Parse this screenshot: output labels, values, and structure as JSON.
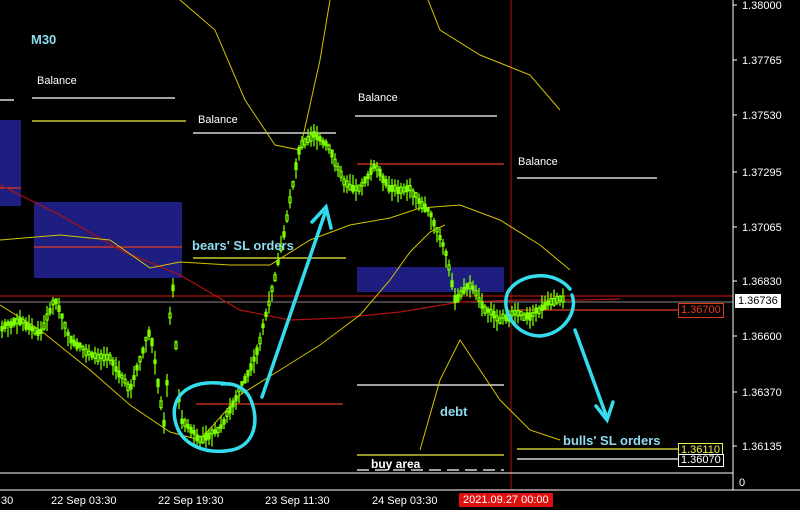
{
  "timeframe": "M30",
  "price_axis": {
    "ticks": [
      "1.38000",
      "1.37765",
      "1.37530",
      "1.37295",
      "1.37065",
      "1.36830",
      "1.36600",
      "1.36370",
      "1.36135"
    ],
    "bottom_value": "0"
  },
  "time_axis": {
    "ticks": [
      "30",
      "22 Sep 03:30",
      "22 Sep 19:30",
      "23 Sep 11:30",
      "24 Sep 03:30"
    ],
    "cursor_label": "2021.09.27 00:00"
  },
  "price_tags": [
    {
      "label": "1.36736",
      "style": "current"
    },
    {
      "label": "1.36700",
      "style": "red"
    },
    {
      "label": "1.36110",
      "style": "yellow"
    },
    {
      "label": "1.36070",
      "style": "white"
    }
  ],
  "annotations": {
    "balance_1": "Balance",
    "balance_2": "Balance",
    "balance_3": "Balance",
    "balance_4": "Balance",
    "bears_sl": "bears' SL orders",
    "bulls_sl": "bulls' SL orders",
    "debt": "debt",
    "buy_area": "buy area"
  },
  "colors": {
    "background": "#000000",
    "candle": "#7CFC00",
    "band": "#D4C400",
    "ma": "#B01010",
    "zone": "#1E1E80",
    "arrow": "#33DDEE",
    "annotation_blue": "#8EDCF0",
    "red_line": "#E03A1E",
    "yellow_line": "#F0F040"
  }
}
